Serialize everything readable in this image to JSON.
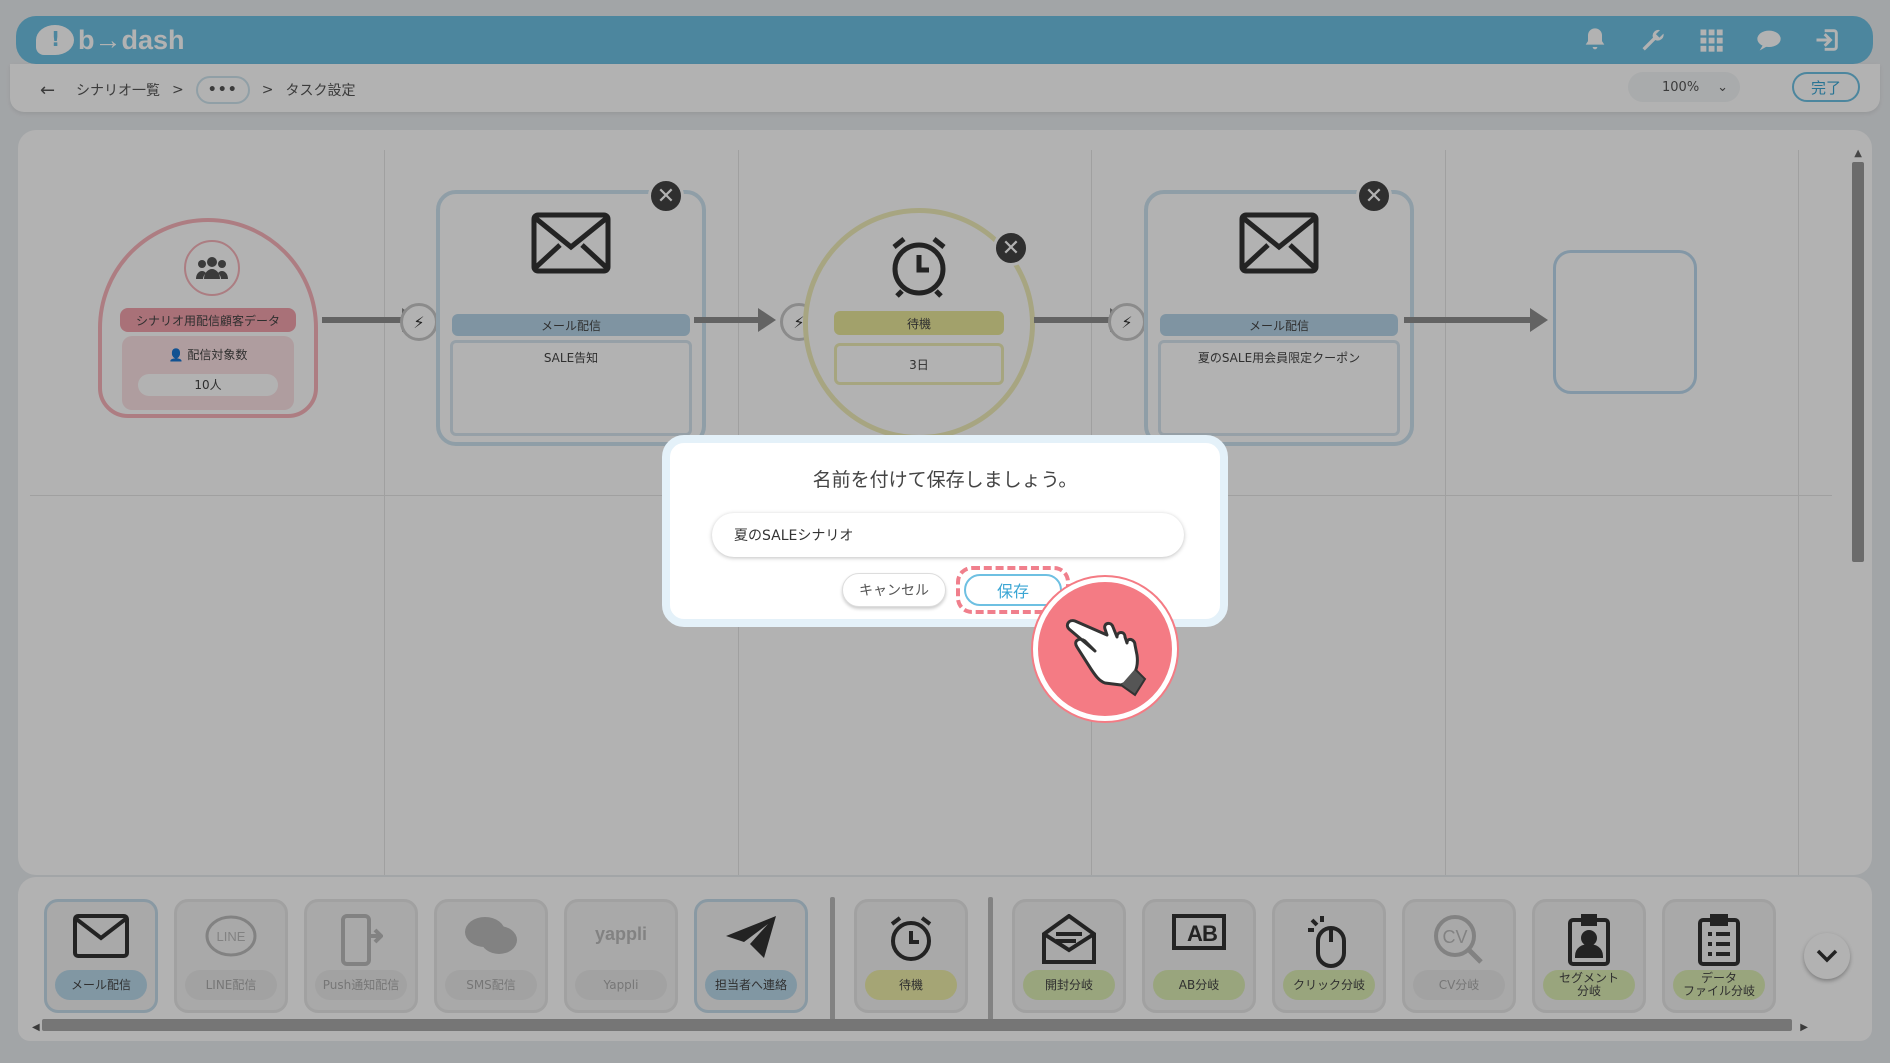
{
  "header": {
    "logo_text": "b→dash",
    "icons": [
      "bell-icon",
      "wrench-icon",
      "apps-grid-icon",
      "chat-icon",
      "logout-icon"
    ]
  },
  "breadcrumb": {
    "back_icon": "←",
    "item1": "シナリオ一覧",
    "sep1": ">",
    "ellipsis": "•••",
    "sep2": ">",
    "current": "タスク設定"
  },
  "toolbar": {
    "zoom": "100%",
    "zoom_caret": "⌄",
    "done_label": "完了"
  },
  "scenario": {
    "start": {
      "label": "シナリオ用配信顧客データ",
      "sub_title": "配信対象数",
      "sub_value": "10人"
    },
    "node1": {
      "label": "メール配信",
      "body": "SALE告知"
    },
    "wait": {
      "label": "待機",
      "body": "3日"
    },
    "node2": {
      "label": "メール配信",
      "body": "夏のSALE用会員限定クーポン"
    },
    "close_glyph": "✕"
  },
  "palette": {
    "items": [
      {
        "label": "メール配信",
        "icon": "envelope-icon"
      },
      {
        "label": "LINE配信",
        "icon": "line-icon"
      },
      {
        "label": "Push通知配信",
        "icon": "phone-icon"
      },
      {
        "label": "SMS配信",
        "icon": "sms-icon"
      },
      {
        "label": "Yappli",
        "icon": "yappli-icon"
      },
      {
        "label": "担当者へ連絡",
        "icon": "paper-plane-icon"
      },
      {
        "label": "待機",
        "icon": "alarm-clock-icon"
      },
      {
        "label": "開封分岐",
        "icon": "open-envelope-icon"
      },
      {
        "label": "AB分岐",
        "icon": "ab-icon"
      },
      {
        "label": "クリック分岐",
        "icon": "mouse-icon"
      },
      {
        "label": "CV分岐",
        "icon": "cv-icon"
      },
      {
        "label": "セグメント\n分岐",
        "icon": "id-badge-icon"
      },
      {
        "label": "データ\nファイル分岐",
        "icon": "clipboard-icon"
      }
    ],
    "line_text": "LINE",
    "yappli_text": "yappli"
  },
  "dialog": {
    "title": "名前を付けて保存しましょう。",
    "input_value": "夏のSALEシナリオ",
    "cancel_label": "キャンセル",
    "save_label": "保存"
  },
  "colors": {
    "header": "#6ec0e2",
    "accent": "#3aa6d4",
    "highlight": "#f07f8c",
    "start_node": "#f3a3ad",
    "wait_node": "#e8e79a"
  }
}
